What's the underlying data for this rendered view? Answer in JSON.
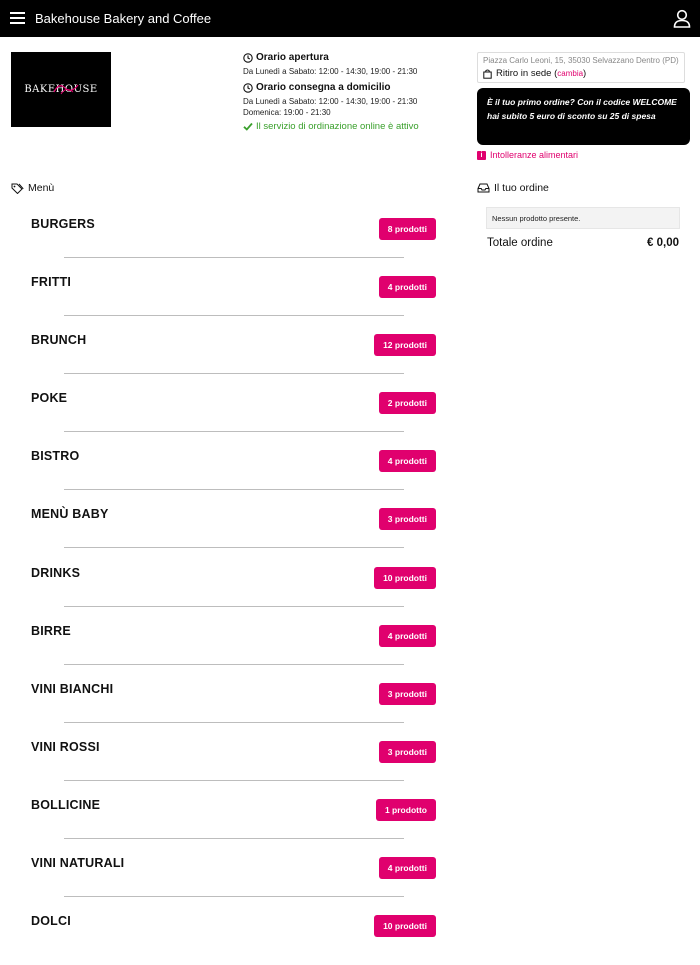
{
  "header": {
    "title": "Bakehouse Bakery and Coffee"
  },
  "logo": {
    "text": "BAKEHOUSE"
  },
  "hours": {
    "opening_title": "Orario apertura",
    "opening_line": "Da Lunedì a Sabato: 12:00 - 14:30, 19:00 - 21:30",
    "delivery_title": "Orario consegna a domicilio",
    "delivery_line1": "Da Lunedì a Sabato: 12:00 - 14:30, 19:00 - 21:30",
    "delivery_line2": "Domenica: 19:00 - 21:30",
    "status": "Il servizio di ordinazione online è attivo"
  },
  "store": {
    "address": "Piazza Carlo Leoni, 15, 35030 Selvazzano Dentro (PD)",
    "pickup_label": "Ritiro in sede (",
    "change_label": "cambia",
    "pickup_close": ")"
  },
  "promo": {
    "text": "È il tuo primo ordine? Con il codice WELCOME hai subito 5 euro di sconto su 25 di spesa"
  },
  "allergens": {
    "label": "Intolleranze alimentari"
  },
  "menu": {
    "heading": "Menù",
    "categories": [
      {
        "name": "BURGERS",
        "count": "8 prodotti"
      },
      {
        "name": "FRITTI",
        "count": "4 prodotti"
      },
      {
        "name": "BRUNCH",
        "count": "12 prodotti"
      },
      {
        "name": "POKE",
        "count": "2 prodotti"
      },
      {
        "name": "BISTRO",
        "count": "4 prodotti"
      },
      {
        "name": "MENÙ BABY",
        "count": "3 prodotti"
      },
      {
        "name": "DRINKS",
        "count": "10 prodotti"
      },
      {
        "name": "BIRRE",
        "count": "4 prodotti"
      },
      {
        "name": "VINI BIANCHI",
        "count": "3 prodotti"
      },
      {
        "name": "VINI ROSSI",
        "count": "3 prodotti"
      },
      {
        "name": "BOLLICINE",
        "count": "1 prodotto"
      },
      {
        "name": "VINI NATURALI",
        "count": "4 prodotti"
      },
      {
        "name": "DOLCI",
        "count": "10 prodotti"
      }
    ]
  },
  "order": {
    "heading": "Il tuo ordine",
    "empty_text": "Nessun prodotto presente.",
    "total_label": "Totale ordine",
    "total_value": "€ 0,00"
  },
  "colors": {
    "accent": "#e0006e",
    "success": "#3aa02c",
    "topbar": "#000000"
  },
  "icons": [
    "hamburger-icon",
    "user-icon",
    "clock-icon",
    "check-icon",
    "bag-icon",
    "info-icon",
    "tag-icon",
    "inbox-icon"
  ]
}
